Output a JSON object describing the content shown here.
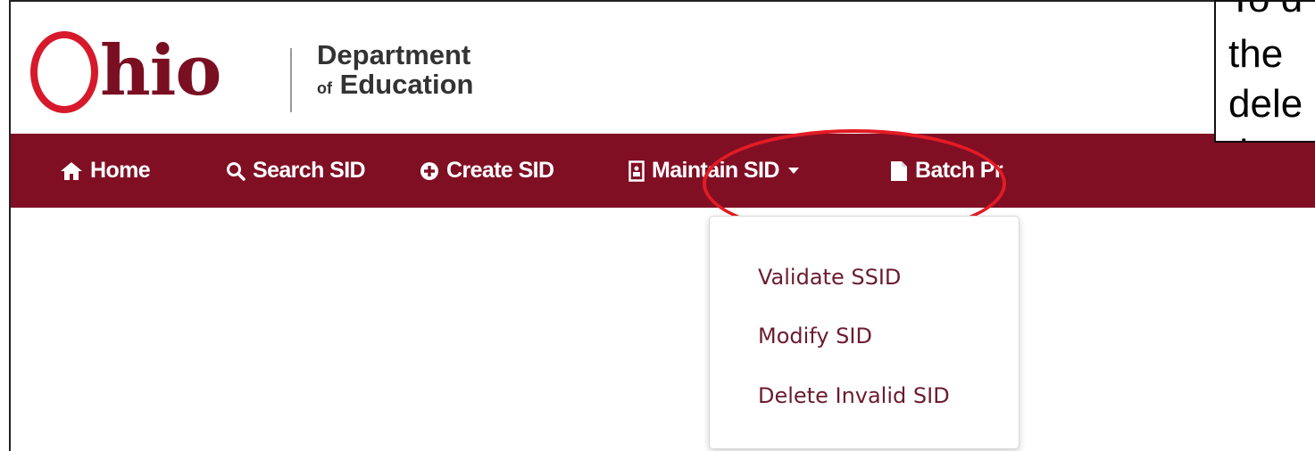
{
  "header": {
    "logo_ohio": "Ohio",
    "logo_line1": "Department",
    "logo_of": "of",
    "logo_line2": "Education"
  },
  "nav": {
    "home": "Home",
    "search": "Search SID",
    "create": "Create SID",
    "maintain": "Maintain SID",
    "batch": "Batch Pr"
  },
  "dropdown": {
    "items": [
      "Validate SSID",
      "Modify SID",
      "Delete Invalid SID"
    ]
  },
  "callout": {
    "lines": [
      "To d",
      "the",
      "dele",
      "the"
    ]
  },
  "colors": {
    "navbar": "#800f24",
    "highlight": "#e31b23",
    "logo_maroon": "#7a0f22",
    "logo_red": "#d7192c"
  },
  "icons": {
    "home": "home-icon",
    "search": "search-icon",
    "create": "plus-circle-icon",
    "maintain": "id-card-icon",
    "batch": "file-icon"
  }
}
